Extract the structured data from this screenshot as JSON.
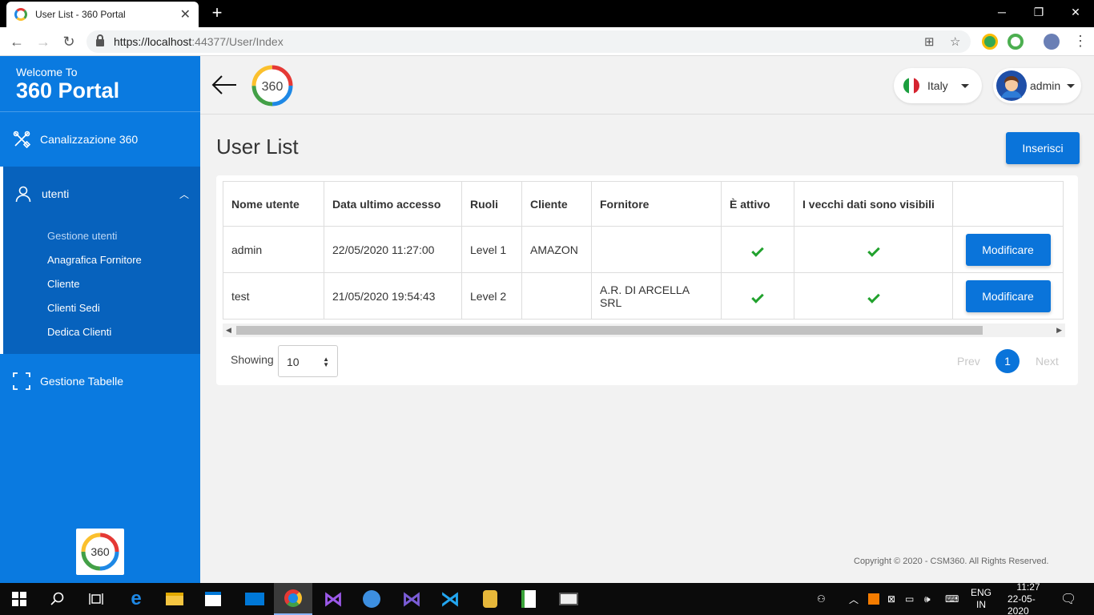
{
  "browser": {
    "tab_title": "User List - 360 Portal",
    "url_scheme_host": "https://localhost",
    "url_port_path": ":44377/User/Index"
  },
  "sidebar": {
    "welcome": "Welcome To",
    "portal": "360 Portal",
    "items": [
      {
        "label": "Canalizzazione 360",
        "icon": "tools-icon"
      },
      {
        "label": "utenti",
        "icon": "user-icon",
        "expanded": true,
        "children": [
          "Gestione utenti",
          "Anagrafica Fornitore",
          "Cliente",
          "Clienti Sedi",
          "Dedica Clienti"
        ],
        "active_child": "Gestione utenti"
      },
      {
        "label": "Gestione Tabelle",
        "icon": "frame-icon"
      }
    ],
    "logo_text": "360"
  },
  "header": {
    "logo_text": "360",
    "language": "Italy",
    "user": "admin"
  },
  "page": {
    "title": "User List",
    "insert_label": "Inserisci"
  },
  "table": {
    "columns": [
      "Nome utente",
      "Data ultimo accesso",
      "Ruoli",
      "Cliente",
      "Fornitore",
      "È attivo",
      "I vecchi dati sono visibili",
      ""
    ],
    "rows": [
      {
        "user": "admin",
        "last_access": "22/05/2020 11:27:00",
        "role": "Level 1",
        "client": "AMAZON",
        "supplier": "",
        "active": true,
        "old_visible": true,
        "action": "Modificare"
      },
      {
        "user": "test",
        "last_access": "21/05/2020 19:54:43",
        "role": "Level 2",
        "client": "",
        "supplier": "A.R. DI ARCELLA SRL",
        "active": true,
        "old_visible": true,
        "action": "Modificare"
      }
    ]
  },
  "pagination": {
    "showing_label": "Showing",
    "page_size": "10",
    "prev": "Prev",
    "current": "1",
    "next": "Next"
  },
  "footer": {
    "copyright": "Copyright © 2020 - CSM360. All Rights Reserved."
  },
  "system_tray": {
    "lang_top": "ENG",
    "lang_bottom": "IN",
    "time": "11:27",
    "date": "22-05-2020"
  },
  "colors": {
    "accent": "#0a74da",
    "sidebar": "#0a7ae0",
    "sidebar_open": "#0762bd",
    "check": "#22a22e"
  }
}
